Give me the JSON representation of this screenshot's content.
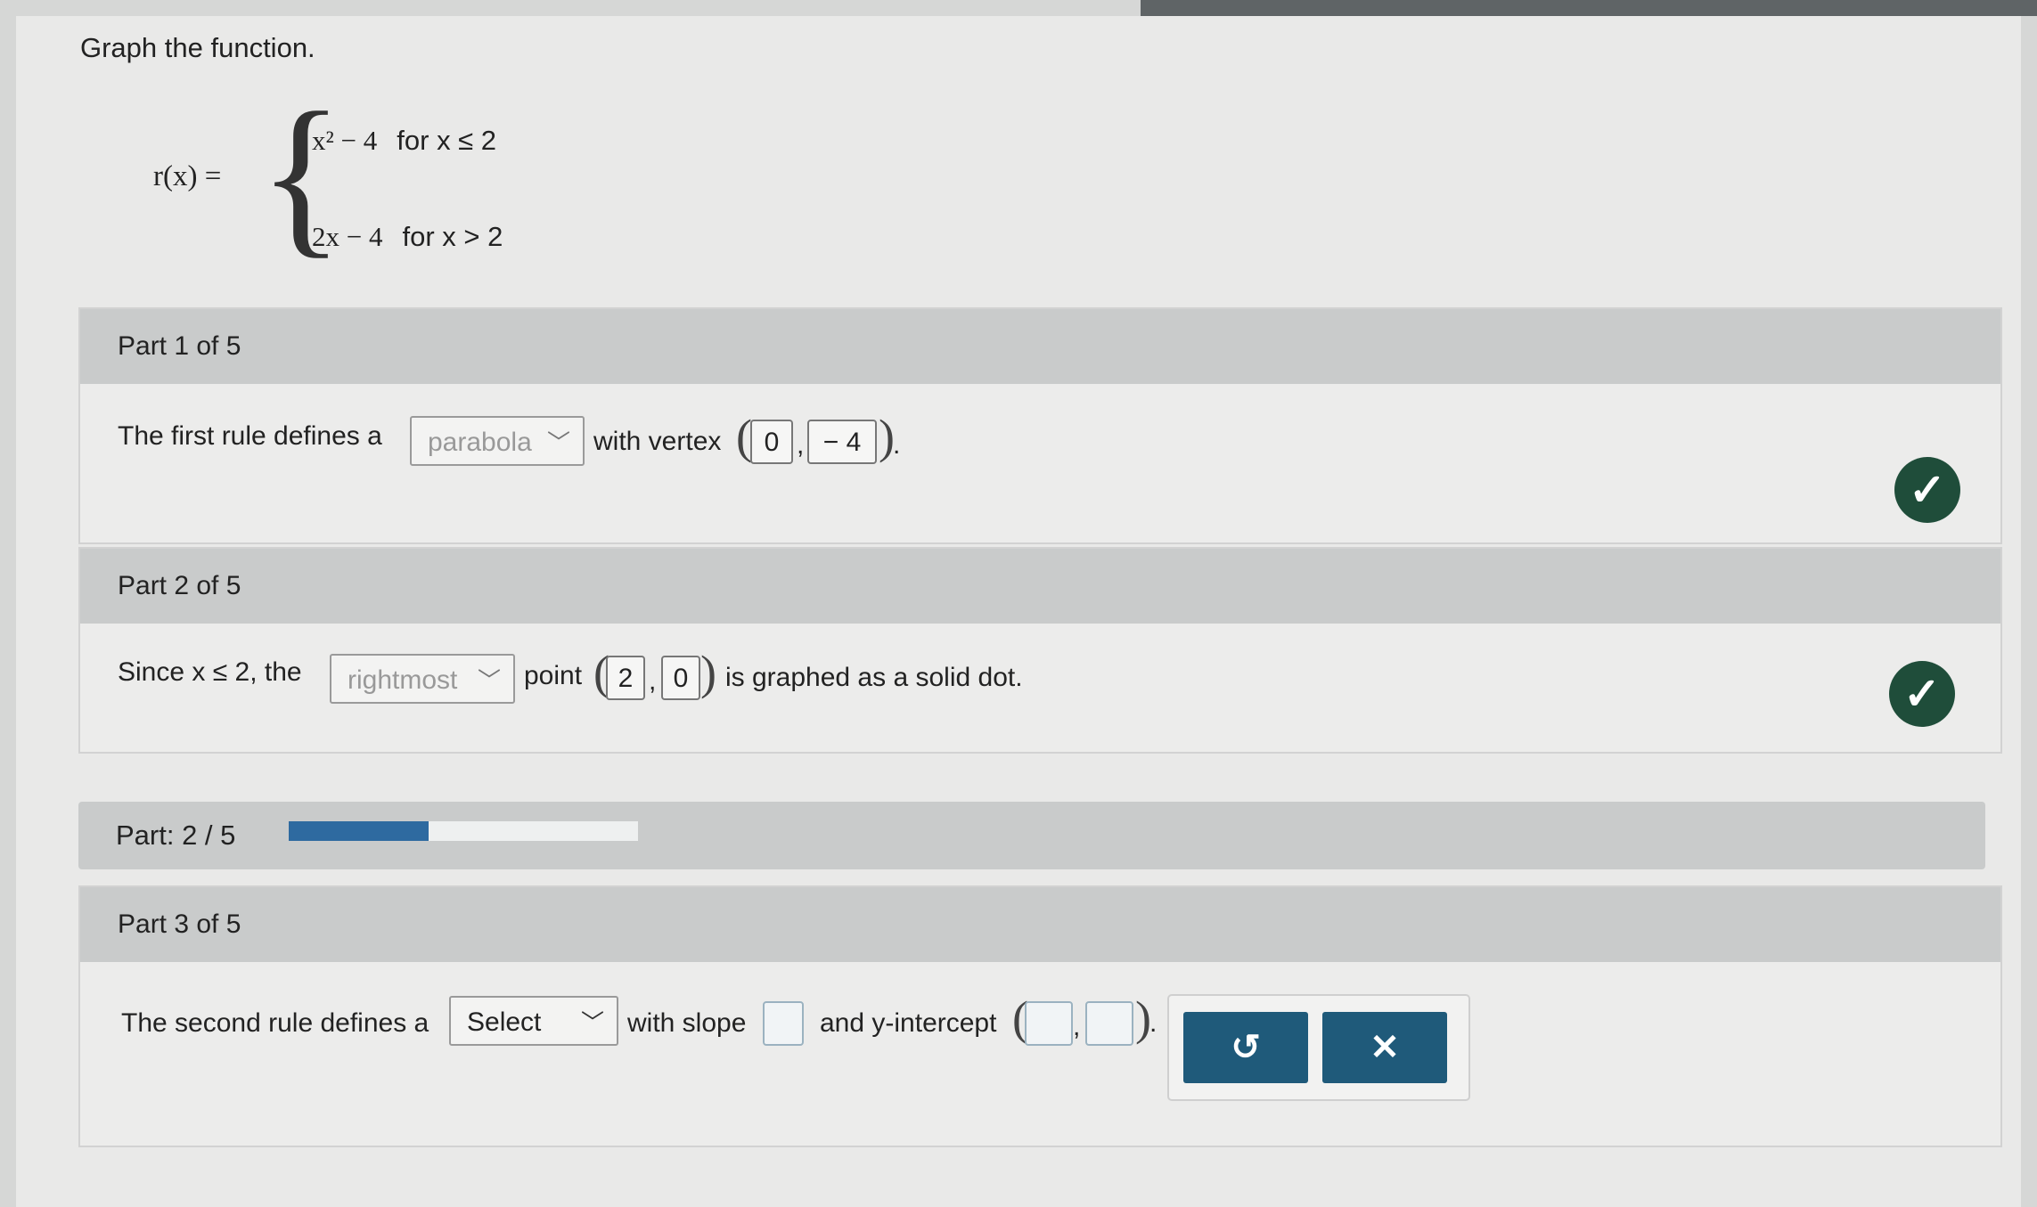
{
  "instruction": "Graph the function.",
  "function": {
    "label": "r(x) =",
    "case1_expr": "x² − 4",
    "case1_cond": "for x ≤ 2",
    "case2_expr": "2x − 4",
    "case2_cond": "for x > 2"
  },
  "part1": {
    "header": "Part 1 of 5",
    "text_before": "The first rule defines a",
    "dropdown_value": "parabola",
    "text_vertex": "with vertex",
    "vertex_x": "0",
    "vertex_y": "− 4",
    "status": "correct"
  },
  "part2": {
    "header": "Part 2 of 5",
    "text_before": "Since x ≤ 2, the",
    "dropdown_value": "rightmost",
    "text_point": "point",
    "point_x": "2",
    "point_y": "0",
    "text_after": "is graphed as a solid dot.",
    "status": "correct"
  },
  "progress": {
    "label": "Part: 2 / 5",
    "fraction": 0.4
  },
  "part3": {
    "header": "Part 3 of 5",
    "text_before": "The second rule defines a",
    "dropdown_value": "Select",
    "text_slope": "with slope",
    "text_intercept": "and y-intercept",
    "slope_value": "",
    "intercept_x": "",
    "intercept_y": ""
  },
  "actions": {
    "undo_icon": "↺",
    "clear_icon": "✕"
  },
  "colors": {
    "check": "#1f4d3a",
    "progress_fill": "#2e6aa0",
    "button": "#1f5a7a"
  }
}
